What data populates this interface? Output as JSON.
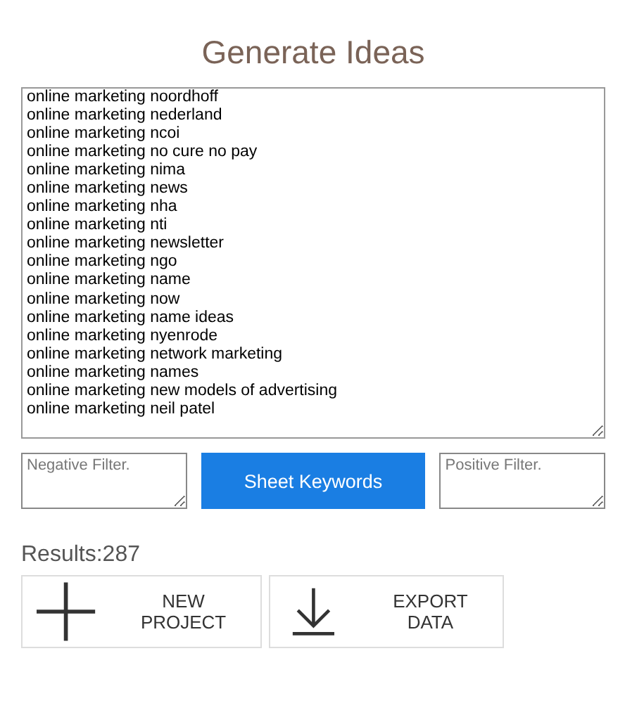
{
  "title": "Generate Ideas",
  "keywords": [
    "online marketing noordhoff",
    "online marketing nederland",
    "online marketing ncoi",
    "online marketing no cure no pay",
    "online marketing nima",
    "online marketing news",
    "online marketing nha",
    "online marketing nti",
    "online marketing newsletter",
    "online marketing ngo",
    "online marketing name",
    "online marketing now",
    "online marketing name ideas",
    "online marketing nyenrode",
    "online marketing network marketing",
    "online marketing names",
    "online marketing new models of advertising",
    "online marketing neil patel"
  ],
  "negative_filter": {
    "placeholder": "Negative Filter."
  },
  "sheet_button": "Sheet Keywords",
  "positive_filter": {
    "placeholder": "Positive Filter."
  },
  "results": "Results:287",
  "actions": [
    {
      "kind": "new",
      "label": "NEW PROJECT"
    },
    {
      "kind": "export",
      "label": "EXPORT DATA"
    }
  ]
}
